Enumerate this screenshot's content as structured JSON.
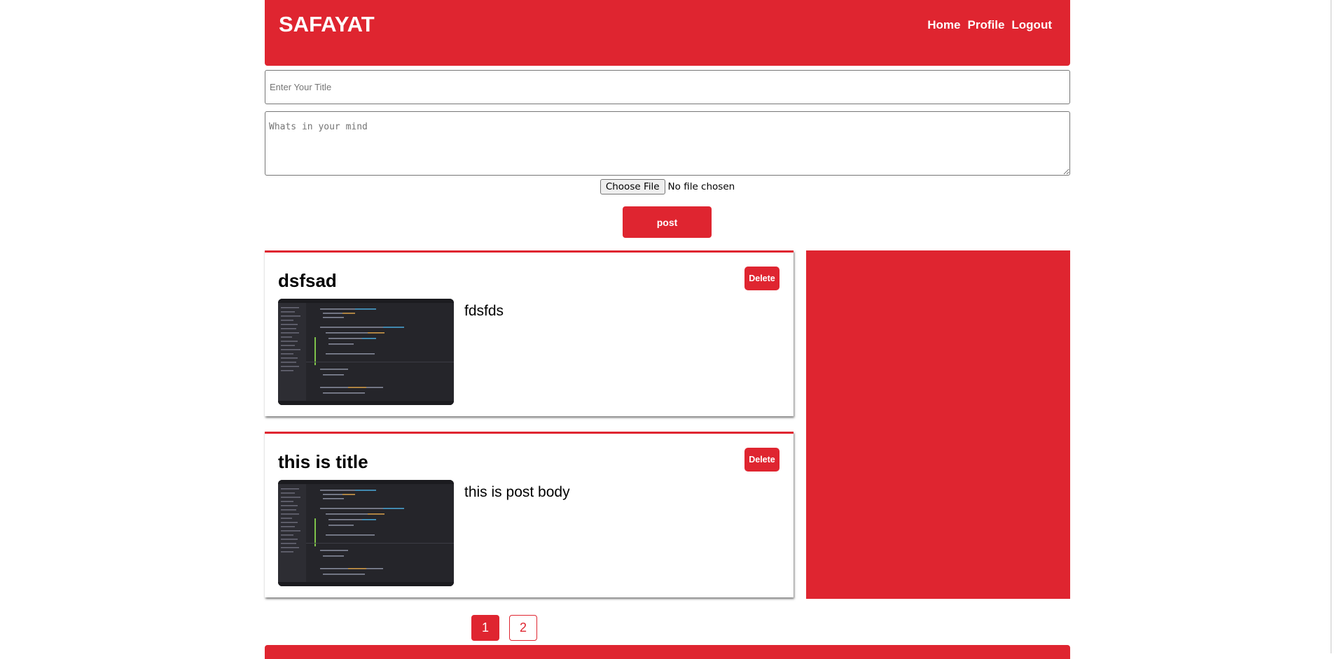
{
  "header": {
    "brand": "SAFAYAT",
    "nav": [
      "Home",
      "Profile",
      "Logout"
    ]
  },
  "form": {
    "title_placeholder": "Enter Your Title",
    "title_value": "",
    "body_placeholder": "Whats in your mind",
    "body_value": "",
    "file_button_label": "Choose File",
    "file_status": "No file chosen",
    "submit_label": "post"
  },
  "posts": [
    {
      "title": "dsfsad",
      "body": "fdsfds",
      "delete_label": "Delete",
      "image_icon": "code-editor-screenshot"
    },
    {
      "title": "this is title",
      "body": "this is post body",
      "delete_label": "Delete",
      "image_icon": "code-editor-screenshot"
    }
  ],
  "pagination": {
    "pages": [
      "1",
      "2"
    ],
    "current": "1"
  },
  "colors": {
    "accent": "#df2530",
    "background": "#ffffff"
  }
}
